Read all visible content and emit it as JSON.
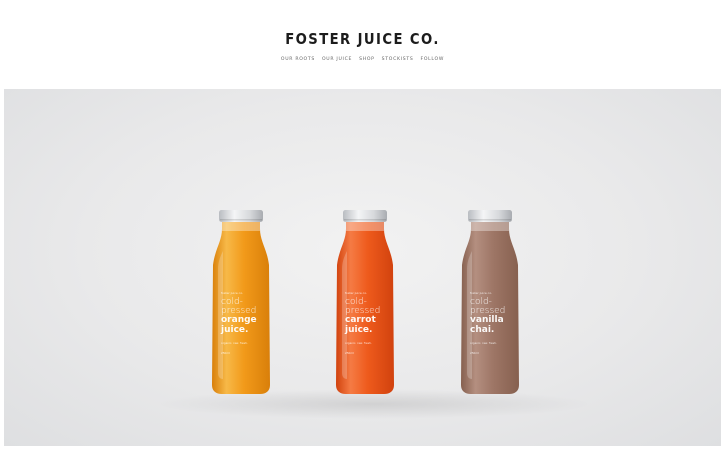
{
  "header": {
    "logo": "FOSTER JUICE CO.",
    "nav": [
      "OUR ROOTS",
      "OUR JUICE",
      "SHOP",
      "STOCKISTS",
      "FOLLOW"
    ]
  },
  "bottles": [
    {
      "flavor": "orange",
      "colors": {
        "juice": "#f29a1a",
        "juice_dark": "#d97f0a",
        "juice_light": "#f7b948"
      },
      "label": {
        "brand": "foster juice co.",
        "line1": "cold-",
        "line2": "pressed",
        "line3": "orange",
        "line4": "juice.",
        "tag": "organic. raw. fresh.",
        "volume": "250ml"
      }
    },
    {
      "flavor": "carrot",
      "colors": {
        "juice": "#ee5a1c",
        "juice_dark": "#d1420e",
        "juice_light": "#f57b44"
      },
      "label": {
        "brand": "foster juice co.",
        "line1": "cold-",
        "line2": "pressed",
        "line3": "carrot",
        "line4": "juice.",
        "tag": "organic. raw. fresh.",
        "volume": "250ml"
      }
    },
    {
      "flavor": "vanilla chai",
      "colors": {
        "juice": "#9e7666",
        "juice_dark": "#86604f",
        "juice_light": "#b48f80"
      },
      "label": {
        "brand": "foster juice co.",
        "line1": "cold-",
        "line2": "pressed",
        "line3": "vanilla",
        "line4": "chai.",
        "tag": "organic. raw. fresh.",
        "volume": "250ml"
      }
    }
  ]
}
